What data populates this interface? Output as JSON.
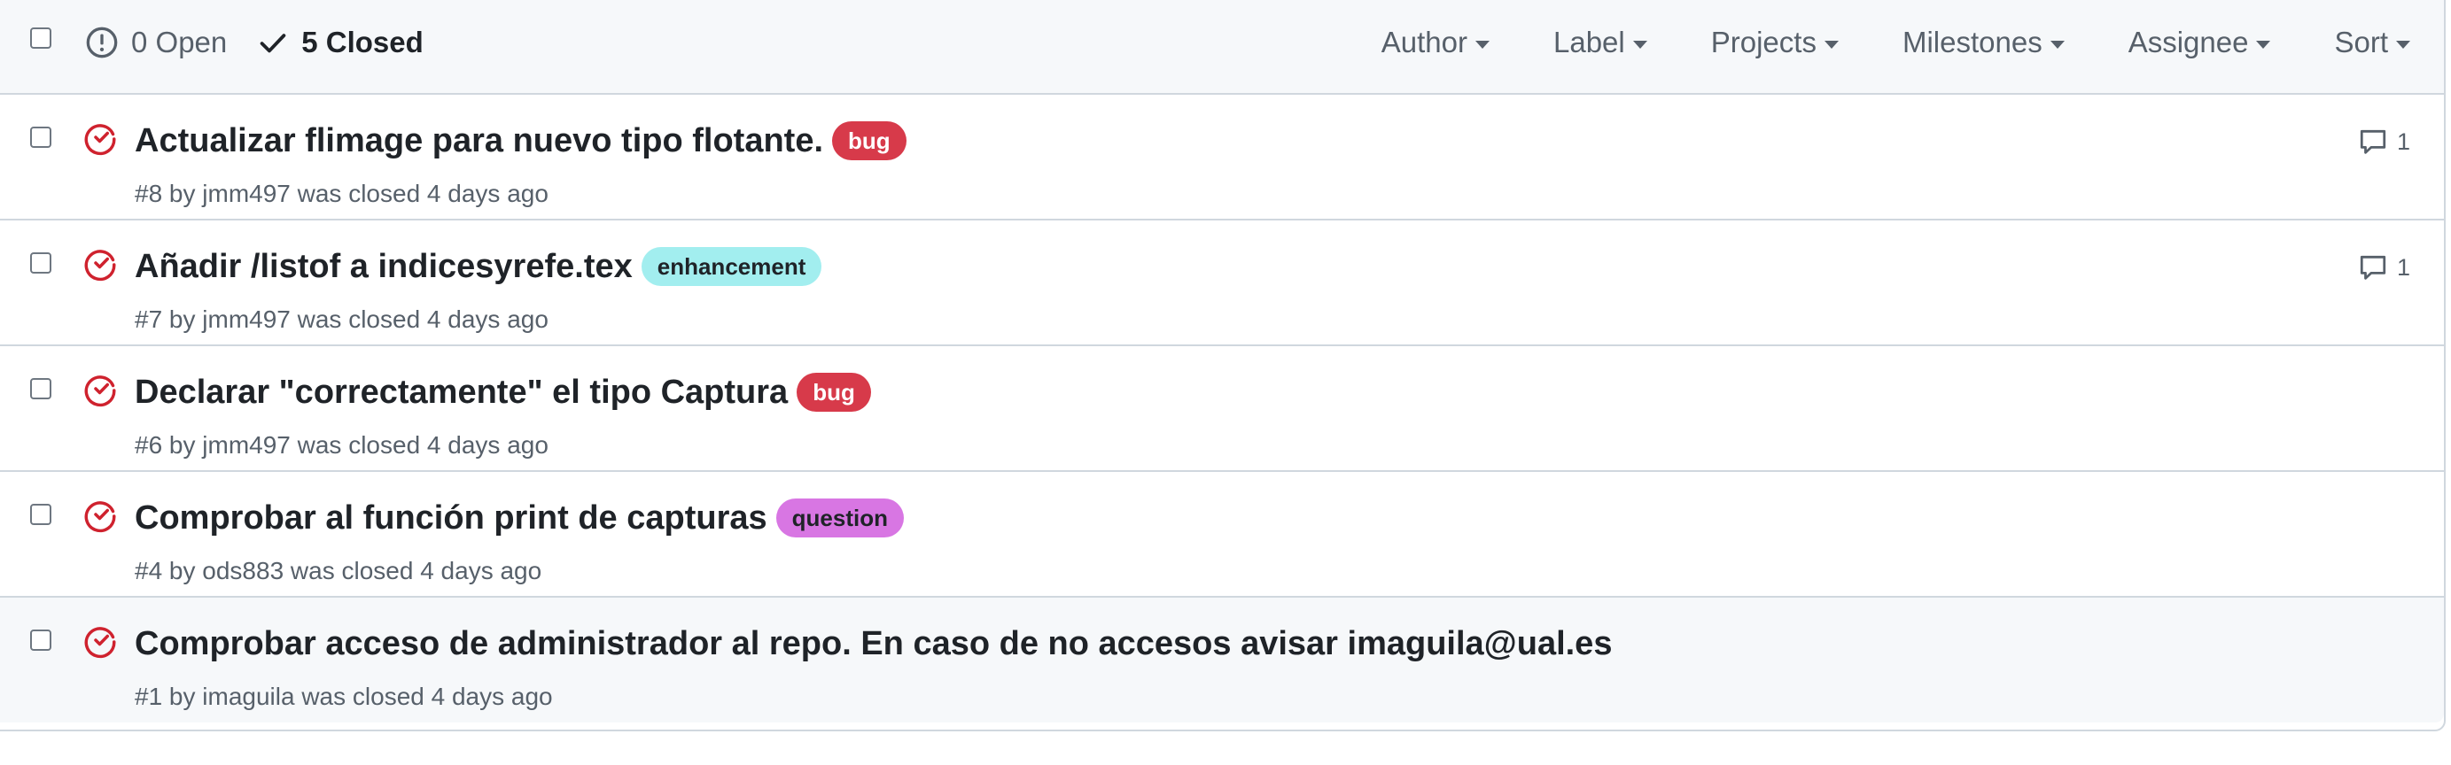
{
  "header": {
    "open_label": "0 Open",
    "closed_label": "5 Closed",
    "filters": [
      "Author",
      "Label",
      "Projects",
      "Milestones",
      "Assignee",
      "Sort"
    ]
  },
  "colors": {
    "closed_icon": "#cf222e",
    "bug": "#d73a4a",
    "enhancement": "#a2eeef",
    "question": "#d876e3"
  },
  "issues": [
    {
      "title": "Actualizar flimage para nuevo tipo flotante.",
      "label": "bug",
      "meta": "#8 by jmm497 was closed 4 days ago",
      "comments": "1"
    },
    {
      "title": "Añadir /listof a indicesyrefe.tex",
      "label": "enhancement",
      "meta": "#7 by jmm497 was closed 4 days ago",
      "comments": "1"
    },
    {
      "title": "Declarar \"correctamente\" el tipo Captura",
      "label": "bug",
      "meta": "#6 by jmm497 was closed 4 days ago",
      "comments": ""
    },
    {
      "title": "Comprobar al función print de capturas",
      "label": "question",
      "meta": "#4 by ods883 was closed 4 days ago",
      "comments": ""
    },
    {
      "title": "Comprobar acceso de administrador al repo. En caso de no accesos avisar imaguila@ual.es",
      "label": "",
      "meta": "#1 by imaguila was closed 4 days ago",
      "comments": ""
    }
  ]
}
